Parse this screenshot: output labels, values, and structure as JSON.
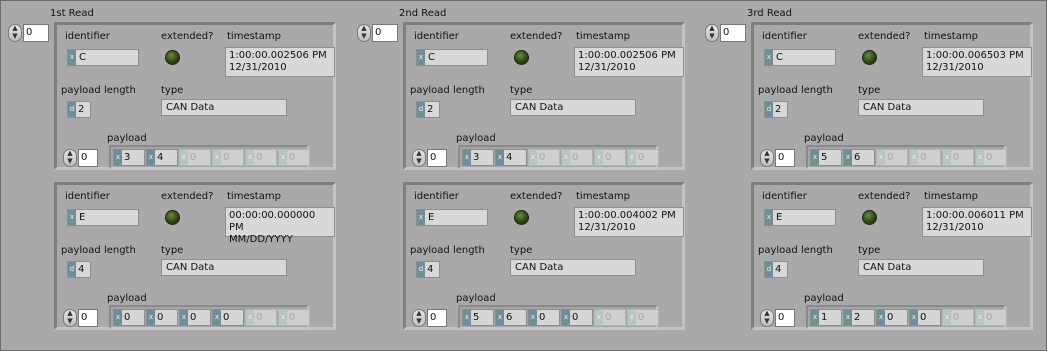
{
  "reads": [
    {
      "title": "1st Read",
      "index": "0",
      "frames": [
        {
          "identifier_label": "identifier",
          "identifier_tag": "x",
          "identifier": "C",
          "extended_label": "extended?",
          "timestamp_label": "timestamp",
          "timestamp_time": "1:00:00.002506 PM",
          "timestamp_date": "12/31/2010",
          "payload_length_label": "payload length",
          "payload_length_tag": "d",
          "payload_length": "2",
          "type_label": "type",
          "type": "CAN Data",
          "payload_label": "payload",
          "payload_index": "0",
          "payload": [
            "3",
            "4",
            "0",
            "0",
            "0",
            "0"
          ],
          "payload_tags": [
            "x",
            "x",
            "x",
            "x",
            "x",
            "x"
          ]
        },
        {
          "identifier_label": "identifier",
          "identifier_tag": "x",
          "identifier": "E",
          "extended_label": "extended?",
          "timestamp_label": "timestamp",
          "timestamp_time": "00:00:00.000000 PM",
          "timestamp_date": "MM/DD/YYYY",
          "payload_length_label": "payload length",
          "payload_length_tag": "d",
          "payload_length": "4",
          "type_label": "type",
          "type": "CAN Data",
          "payload_label": "payload",
          "payload_index": "0",
          "payload": [
            "0",
            "0",
            "0",
            "0",
            "0",
            "0"
          ],
          "payload_tags": [
            "x",
            "x",
            "x",
            "x",
            "x",
            "x"
          ]
        }
      ]
    },
    {
      "title": "2nd Read",
      "index": "0",
      "frames": [
        {
          "identifier_label": "identifier",
          "identifier_tag": "x",
          "identifier": "C",
          "extended_label": "extended?",
          "timestamp_label": "timestamp",
          "timestamp_time": "1:00:00.002506 PM",
          "timestamp_date": "12/31/2010",
          "payload_length_label": "payload length",
          "payload_length_tag": "d",
          "payload_length": "2",
          "type_label": "type",
          "type": "CAN Data",
          "payload_label": "payload",
          "payload_index": "0",
          "payload": [
            "3",
            "4",
            "0",
            "0",
            "0",
            "0"
          ],
          "payload_tags": [
            "x",
            "x",
            "x",
            "x",
            "x",
            "x"
          ]
        },
        {
          "identifier_label": "identifier",
          "identifier_tag": "x",
          "identifier": "E",
          "extended_label": "extended?",
          "timestamp_label": "timestamp",
          "timestamp_time": "1:00:00.004002 PM",
          "timestamp_date": "12/31/2010",
          "payload_length_label": "payload length",
          "payload_length_tag": "d",
          "payload_length": "4",
          "type_label": "type",
          "type": "CAN Data",
          "payload_label": "payload",
          "payload_index": "0",
          "payload": [
            "5",
            "6",
            "0",
            "0",
            "0",
            "0"
          ],
          "payload_tags": [
            "x",
            "x",
            "x",
            "x",
            "x",
            "x"
          ]
        }
      ]
    },
    {
      "title": "3rd Read",
      "index": "0",
      "frames": [
        {
          "identifier_label": "identifier",
          "identifier_tag": "x",
          "identifier": "C",
          "extended_label": "extended?",
          "timestamp_label": "timestamp",
          "timestamp_time": "1:00:00.006503 PM",
          "timestamp_date": "12/31/2010",
          "payload_length_label": "payload length",
          "payload_length_tag": "d",
          "payload_length": "2",
          "type_label": "type",
          "type": "CAN Data",
          "payload_label": "payload",
          "payload_index": "0",
          "payload": [
            "5",
            "6",
            "0",
            "0",
            "0",
            "0"
          ],
          "payload_tags": [
            "x",
            "x",
            "x",
            "x",
            "x",
            "x"
          ]
        },
        {
          "identifier_label": "identifier",
          "identifier_tag": "x",
          "identifier": "E",
          "extended_label": "extended?",
          "timestamp_label": "timestamp",
          "timestamp_time": "1:00:00.006011 PM",
          "timestamp_date": "12/31/2010",
          "payload_length_label": "payload length",
          "payload_length_tag": "d",
          "payload_length": "4",
          "type_label": "type",
          "type": "CAN Data",
          "payload_label": "payload",
          "payload_index": "0",
          "payload": [
            "1",
            "2",
            "0",
            "0",
            "0",
            "0"
          ],
          "payload_tags": [
            "x",
            "x",
            "x",
            "x",
            "x",
            "x"
          ]
        }
      ]
    }
  ],
  "colors": {
    "background": "#a9a9a9",
    "indicator": "#d8d8d8",
    "radix_tag": "#6f8f96",
    "led_off": "#2f4613"
  }
}
